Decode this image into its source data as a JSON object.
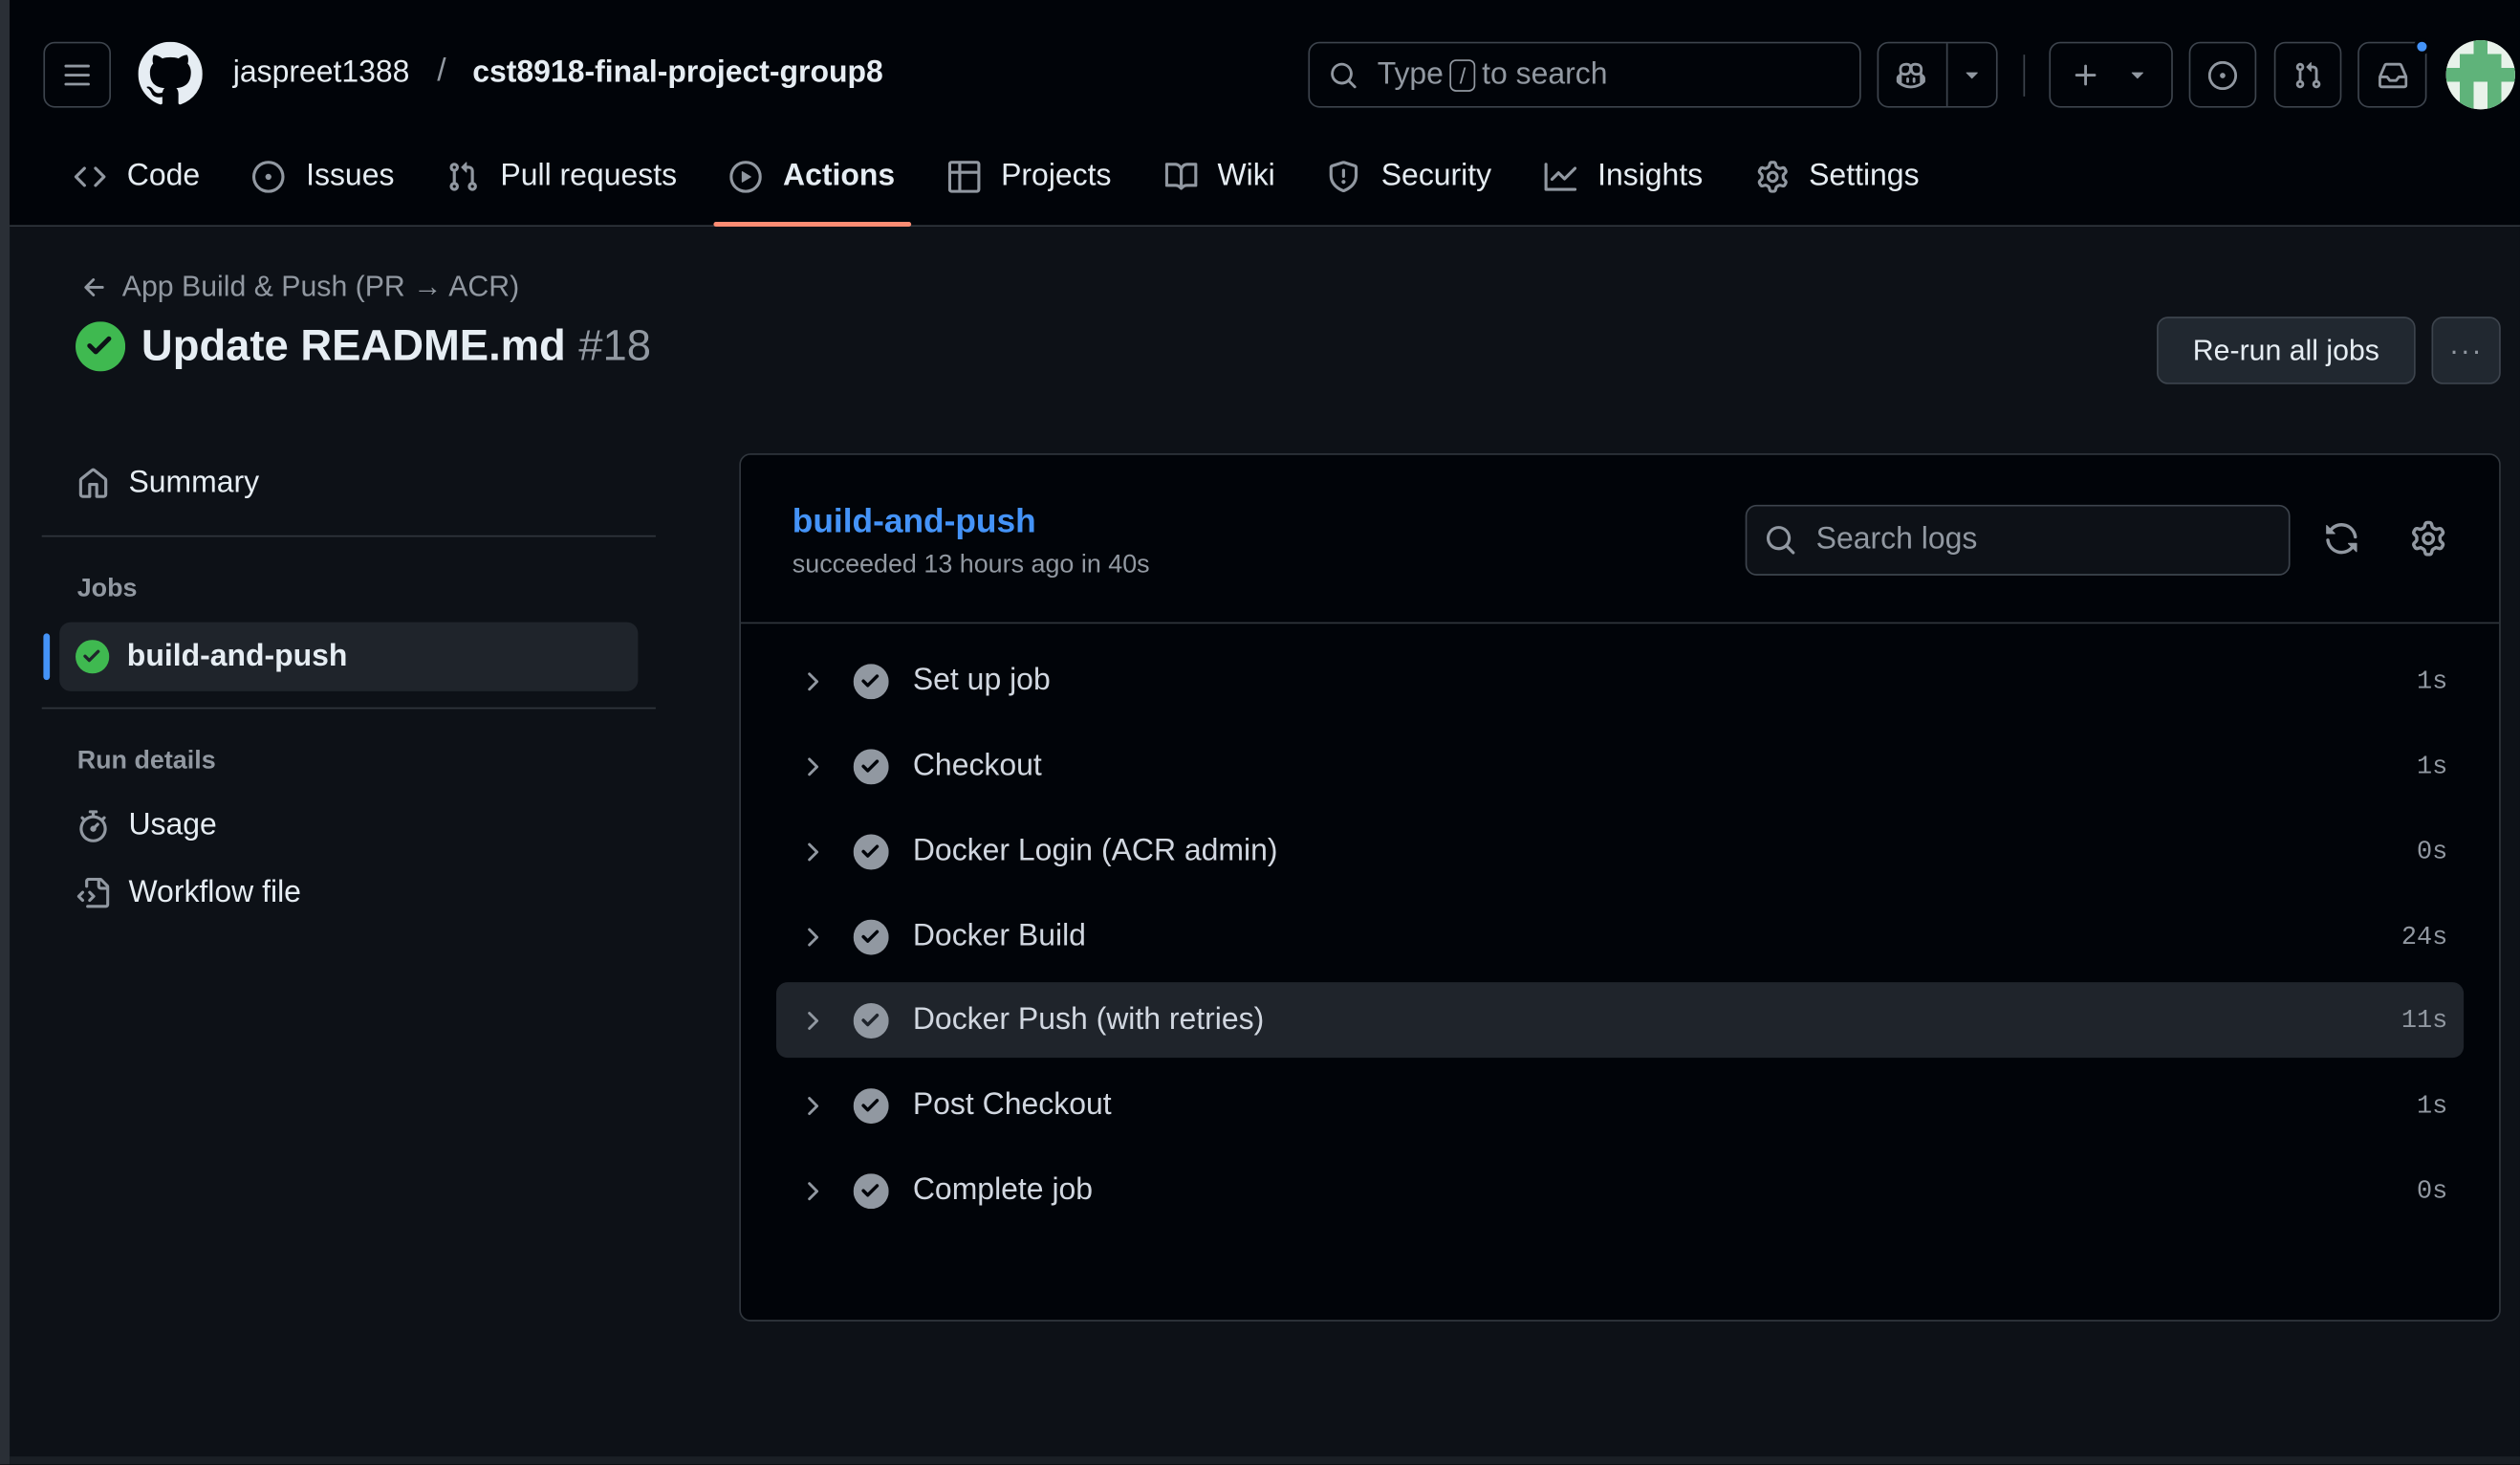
{
  "header": {
    "owner": "jaspreet1388",
    "separator": "/",
    "repo": "cst8918-final-project-group8",
    "search": {
      "prefix": "Type",
      "key": "/",
      "suffix": "to search"
    }
  },
  "tabs": [
    {
      "label": "Code",
      "icon": "code-icon"
    },
    {
      "label": "Issues",
      "icon": "issue-icon"
    },
    {
      "label": "Pull requests",
      "icon": "pull-request-icon"
    },
    {
      "label": "Actions",
      "icon": "play-icon",
      "active": true
    },
    {
      "label": "Projects",
      "icon": "table-icon"
    },
    {
      "label": "Wiki",
      "icon": "book-icon"
    },
    {
      "label": "Security",
      "icon": "shield-icon"
    },
    {
      "label": "Insights",
      "icon": "graph-icon"
    },
    {
      "label": "Settings",
      "icon": "gear-icon"
    }
  ],
  "run": {
    "back_label": "App Build & Push (PR → ACR)",
    "title": "Update README.md",
    "number": "#18",
    "status": "success",
    "rerun_label": "Re-run all jobs",
    "more_label": "···"
  },
  "sidebar": {
    "summary_label": "Summary",
    "jobs_heading": "Jobs",
    "job_label": "build-and-push",
    "run_details_heading": "Run details",
    "usage_label": "Usage",
    "workflow_file_label": "Workflow file"
  },
  "job": {
    "name": "build-and-push",
    "meta": "succeeded 13 hours ago in 40s",
    "search_placeholder": "Search logs",
    "steps": [
      {
        "label": "Set up job",
        "duration": "1s"
      },
      {
        "label": "Checkout",
        "duration": "1s"
      },
      {
        "label": "Docker Login (ACR admin)",
        "duration": "0s"
      },
      {
        "label": "Docker Build",
        "duration": "24s"
      },
      {
        "label": "Docker Push (with retries)",
        "duration": "11s"
      },
      {
        "label": "Post Checkout",
        "duration": "1s"
      },
      {
        "label": "Complete job",
        "duration": "0s"
      }
    ]
  },
  "colors": {
    "accent_link": "#4493f8",
    "success": "#3fb950",
    "active_tab_underline": "#fd8c73",
    "background": "#0d1117"
  }
}
